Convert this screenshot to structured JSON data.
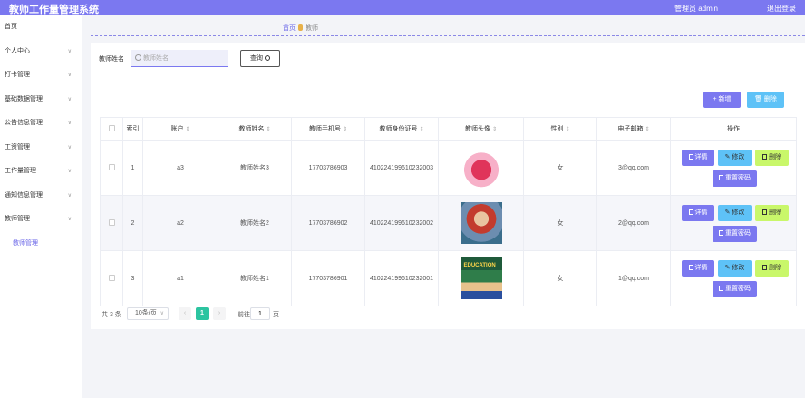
{
  "header": {
    "title": "教师工作量管理系统",
    "user": "管理员 admin",
    "logout": "退出登录"
  },
  "sidebar": {
    "items": [
      {
        "label": "首页",
        "chevron": ""
      },
      {
        "label": "个人中心",
        "chevron": "∨"
      },
      {
        "label": "打卡管理",
        "chevron": "∨"
      },
      {
        "label": "基础数据管理",
        "chevron": "∨"
      },
      {
        "label": "公告信息管理",
        "chevron": "∨"
      },
      {
        "label": "工资管理",
        "chevron": "∨"
      },
      {
        "label": "工作量管理",
        "chevron": "∨"
      },
      {
        "label": "通知信息管理",
        "chevron": "∨"
      },
      {
        "label": "教师管理",
        "chevron": "∨"
      }
    ],
    "sub_item": "教师管理"
  },
  "breadcrumb": {
    "home": "首页",
    "current": "教师"
  },
  "search": {
    "label": "教师姓名",
    "placeholder": "教师姓名",
    "value": "",
    "button": "查询"
  },
  "toolbar": {
    "add": "新增",
    "delete": "删除"
  },
  "table": {
    "headers": {
      "index": "索引",
      "account": "账户",
      "name": "教师姓名",
      "phone": "教师手机号",
      "idcard": "教师身份证号",
      "avatar": "教师头像",
      "gender": "性别",
      "email": "电子邮箱",
      "ops": "操作"
    },
    "sort_icon": "⇕",
    "rows": [
      {
        "index": "1",
        "account": "a3",
        "name": "教师姓名3",
        "phone": "17703786903",
        "idcard": "410224199610232003",
        "gender": "女",
        "email": "3@qq.com"
      },
      {
        "index": "2",
        "account": "a2",
        "name": "教师姓名2",
        "phone": "17703786902",
        "idcard": "410224199610232002",
        "gender": "女",
        "email": "2@qq.com"
      },
      {
        "index": "3",
        "account": "a1",
        "name": "教师姓名1",
        "phone": "17703786901",
        "idcard": "410224199610232001",
        "gender": "女",
        "email": "1@qq.com"
      }
    ],
    "ops": {
      "detail": "详情",
      "edit": "修改",
      "delete": "删除",
      "reset": "重置密码"
    },
    "avatar_text": "EDUCATION"
  },
  "pager": {
    "total": "共 3 条",
    "size": "10条/页",
    "prev": "‹",
    "current": "1",
    "next": "›",
    "goto": "前往",
    "jump_value": "1",
    "unit": "页"
  },
  "colors": {
    "accent": "#7b78f0",
    "info": "#5ec2f7",
    "success": "#c9f76a",
    "page_active": "#2cc4a0"
  }
}
